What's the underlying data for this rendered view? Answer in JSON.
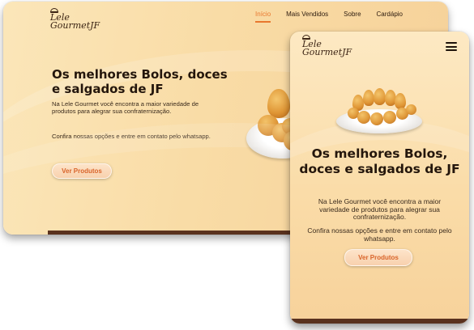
{
  "brand": {
    "logo_line1": "Lele",
    "logo_line2": "GourmetJF"
  },
  "desktop": {
    "nav": [
      "Início",
      "Mais Vendidos",
      "Sobre",
      "Cardápio"
    ],
    "active_nav": "Início",
    "hero_title": "Os melhores Bolos, doces e salgados de JF",
    "paragraph1": "Na Lele Gourmet você encontra a maior variedade de produtos para alegrar sua confraternização.",
    "paragraph2": "Confira nossas opções e entre em contato pelo whatsapp.",
    "cta_label": "Ver Produtos"
  },
  "mobile": {
    "hero_title": "Os melhores Bolos, doces e salgados de JF",
    "paragraph1": "Na Lele Gourmet você encontra a maior variedade de produtos para alegrar sua confraternização.",
    "paragraph2": "Confira nossas opções e entre em contato pelo whatsapp.",
    "cta_label": "Ver Produtos",
    "menu_icon": "hamburger-icon"
  },
  "colors": {
    "accent": "#e8772e",
    "text_dark": "#24160c",
    "footer": "#5a321e",
    "bg": "#fadca8"
  }
}
